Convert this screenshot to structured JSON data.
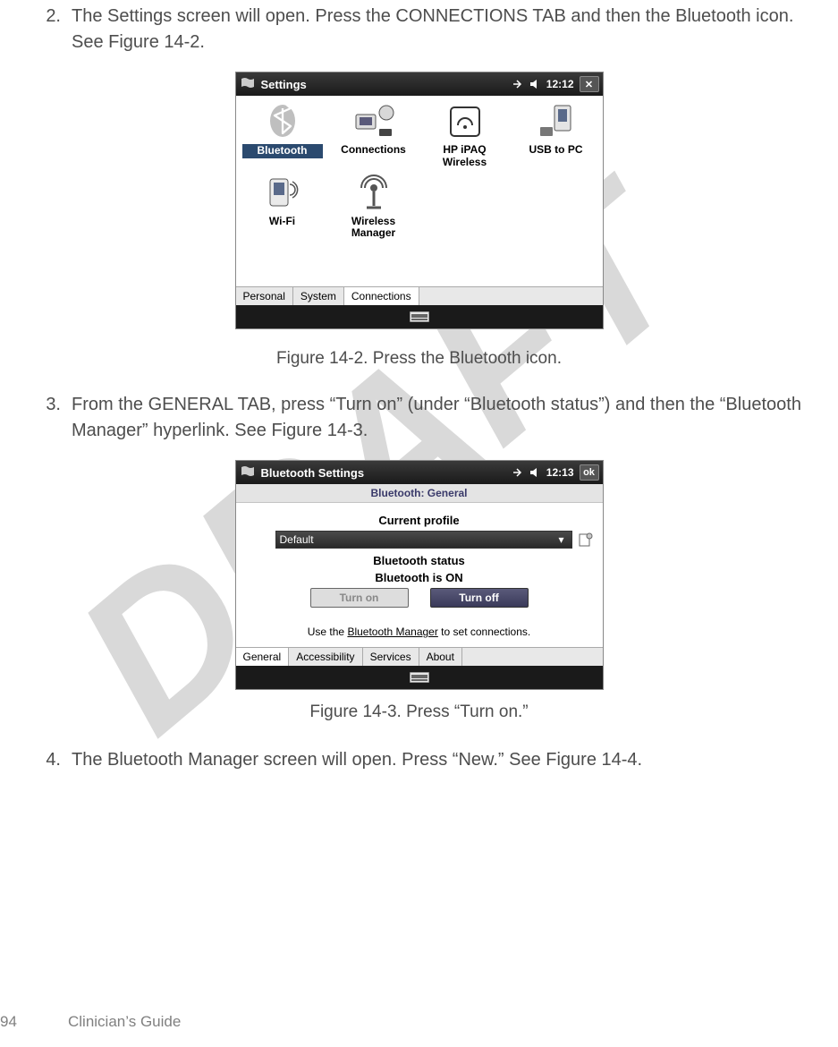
{
  "watermark_text": "DRAFT",
  "steps": {
    "s2": {
      "num": "2.",
      "text": "The Settings screen will open. Press the CONNECTIONS TAB and then the Bluetooth icon. See Figure 14-2."
    },
    "s3": {
      "num": "3.",
      "text": "From the GENERAL TAB, press “Turn on” (under “Bluetooth status”) and then the “Bluetooth Manager” hyperlink. See Figure 14-3."
    },
    "s4": {
      "num": "4.",
      "text": "The Bluetooth Manager screen will open. Press “New.” See Figure 14-4."
    }
  },
  "captions": {
    "fig2": "Figure 14-2. Press the Bluetooth icon.",
    "fig3": "Figure 14-3. Press “Turn on.”"
  },
  "fig2": {
    "title": "Settings",
    "time": "12:12",
    "close": "✕",
    "apps": {
      "bluetooth": "Bluetooth",
      "connections": "Connections",
      "ipaq": "HP iPAQ Wireless",
      "usb": "USB to PC",
      "wifi": "Wi-Fi",
      "wmgr": "Wireless Manager"
    },
    "tabs": {
      "personal": "Personal",
      "system": "System",
      "connections": "Connections"
    }
  },
  "fig3": {
    "title": "Bluetooth Settings",
    "time": "12:13",
    "ok": "ok",
    "header": "Bluetooth: General",
    "profile_label": "Current profile",
    "profile_value": "Default",
    "status_label": "Bluetooth status",
    "status_value": "Bluetooth is ON",
    "turn_on": "Turn on",
    "turn_off": "Turn off",
    "hint_pre": "Use the ",
    "hint_link": "Bluetooth Manager",
    "hint_post": " to set connections.",
    "tabs": {
      "general": "General",
      "accessibility": "Accessibility",
      "services": "Services",
      "about": "About"
    }
  },
  "footer": {
    "page": "94",
    "title": "Clinician’s Guide"
  }
}
